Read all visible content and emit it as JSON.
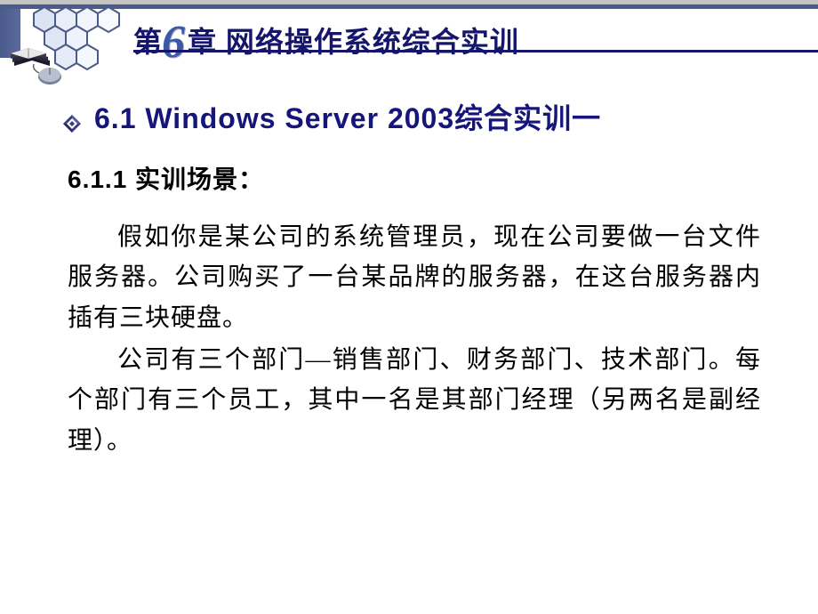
{
  "header": {
    "chapter_prefix": "第",
    "chapter_number": "6",
    "chapter_suffix": "章  网络操作系统综合实训"
  },
  "section": {
    "title": "6.1  Windows Server 2003综合实训一"
  },
  "subsection": {
    "title": "6.1.1 实训场景："
  },
  "paragraphs": {
    "p1": "假如你是某公司的系统管理员，现在公司要做一台文件服务器。公司购买了一台某品牌的服务器，在这台服务器内插有三块硬盘。",
    "p2": "公司有三个部门—销售部门、财务部门、技术部门。每个部门有三个员工，其中一名是其部门经理（另两名是副经理）。"
  }
}
